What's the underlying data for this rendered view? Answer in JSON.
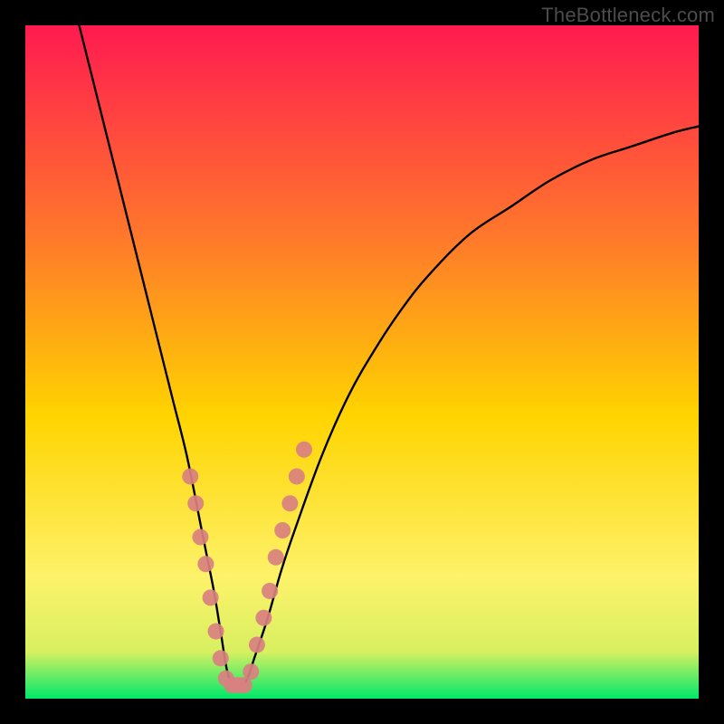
{
  "watermark": "TheBottleneck.com",
  "colors": {
    "gradient_top": "#ff1a50",
    "gradient_mid1": "#ff7a2a",
    "gradient_mid2": "#ffd400",
    "gradient_mid3": "#fdf26a",
    "gradient_bottom": "#00e86b",
    "curve": "#000000",
    "marker_fill": "#d98080",
    "marker_stroke": "#d98080",
    "frame": "#000000"
  },
  "chart_data": {
    "type": "line",
    "title": "",
    "xlabel": "",
    "ylabel": "",
    "xlim": [
      0,
      100
    ],
    "ylim": [
      0,
      100
    ],
    "grid": false,
    "legend": false,
    "series": [
      {
        "name": "bottleneck-curve",
        "x": [
          8,
          10,
          12,
          14,
          16,
          18,
          20,
          22,
          24,
          26,
          27,
          28,
          29,
          30,
          31,
          32,
          33,
          34,
          36,
          38,
          40,
          44,
          48,
          52,
          56,
          60,
          66,
          72,
          78,
          84,
          90,
          96,
          100
        ],
        "y": [
          100,
          92,
          84,
          76,
          68,
          60,
          52,
          44,
          36,
          26,
          21,
          16,
          10,
          4,
          2,
          2,
          3,
          6,
          12,
          19,
          25,
          36,
          45,
          52,
          58,
          63,
          69,
          73,
          77,
          80,
          82,
          84,
          85
        ]
      }
    ],
    "markers": {
      "name": "highlight-points",
      "x": [
        24.5,
        25.3,
        26.0,
        26.8,
        27.5,
        28.3,
        29.0,
        29.8,
        30.7,
        31.6,
        32.5,
        33.5,
        34.4,
        35.4,
        36.3,
        37.2,
        38.2,
        39.3,
        40.3,
        41.4
      ],
      "y": [
        33,
        29,
        24,
        20,
        15,
        10,
        6,
        3,
        2,
        2,
        2,
        4,
        8,
        12,
        16,
        21,
        25,
        29,
        33,
        37
      ]
    }
  }
}
